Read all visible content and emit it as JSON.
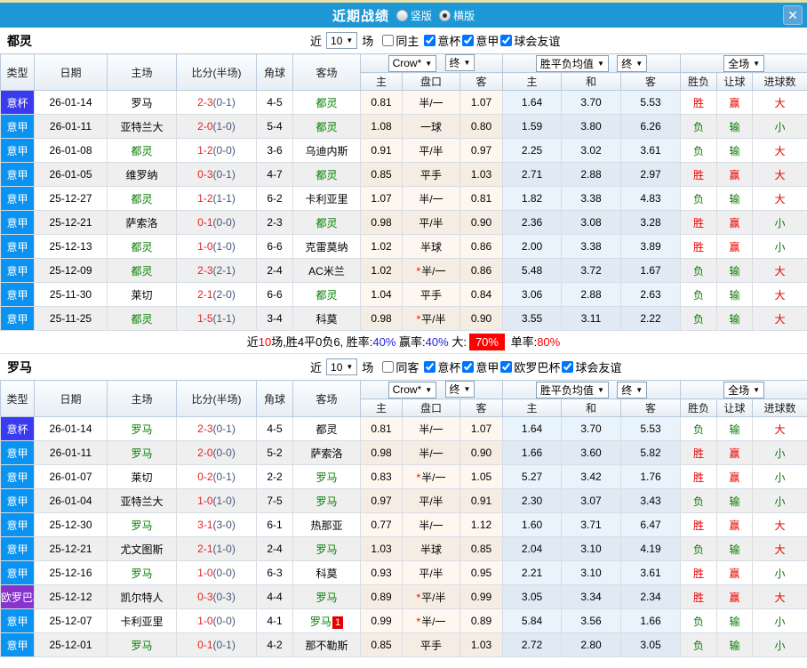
{
  "colors": {
    "titlebar": "#1e97d5",
    "top_strip": "#e9e1aa",
    "league": {
      "意杯": "#3a3af0",
      "意甲": "#0a93f0",
      "欧罗巴杯": "#8833cc"
    },
    "win_red": "#e60000",
    "lose_green": "#067d06",
    "focus_team_green": "#038103",
    "fulltime_score_red": "#e62222",
    "halftime_score_blue": "#44567c",
    "percent_blue": "#2222e6",
    "big_badge_bg": "#ff0000"
  },
  "titlebar": {
    "title": "近期战绩",
    "options": [
      {
        "label": "竖版",
        "selected": false
      },
      {
        "label": "横版",
        "selected": true
      }
    ],
    "close_icon": "✕"
  },
  "table_headers": {
    "type": "类型",
    "date": "日期",
    "home": "主场",
    "score": "比分(半场)",
    "corner": "角球",
    "away": "客场",
    "asia": [
      "主",
      "盘口",
      "客"
    ],
    "europe": [
      "主",
      "和",
      "客"
    ],
    "result": [
      "胜负",
      "让球",
      "进球数"
    ]
  },
  "sections": [
    {
      "team": "都灵",
      "filter": {
        "prefix": "近",
        "count": "10",
        "suffix": "场",
        "same_label": "同主",
        "same_checked": false,
        "leagues": [
          {
            "label": "意杯",
            "checked": true
          },
          {
            "label": "意甲",
            "checked": true
          },
          {
            "label": "球会友谊",
            "checked": true
          }
        ]
      },
      "dropdowns": {
        "bookmaker": "Crow*",
        "final1": "终",
        "avg": "胜平负均值",
        "final2": "终",
        "scope": "全场"
      },
      "rows": [
        {
          "league": "意杯",
          "date": "26-01-14",
          "home": "罗马",
          "home_focus": false,
          "score": "2-3",
          "half": "(0-1)",
          "corner": "4-5",
          "away": "都灵",
          "away_focus": true,
          "redcards": "",
          "h": "0.81",
          "hcap": "半/一",
          "star": false,
          "a": "1.07",
          "w": "1.64",
          "d": "3.70",
          "l": "5.53",
          "res": "胜",
          "rhcap": "赢",
          "rgoal": "大"
        },
        {
          "league": "意甲",
          "date": "26-01-11",
          "home": "亚特兰大",
          "home_focus": false,
          "score": "2-0",
          "half": "(1-0)",
          "corner": "5-4",
          "away": "都灵",
          "away_focus": true,
          "redcards": "",
          "h": "1.08",
          "hcap": "一球",
          "star": false,
          "a": "0.80",
          "w": "1.59",
          "d": "3.80",
          "l": "6.26",
          "res": "负",
          "rhcap": "输",
          "rgoal": "小"
        },
        {
          "league": "意甲",
          "date": "26-01-08",
          "home": "都灵",
          "home_focus": true,
          "score": "1-2",
          "half": "(0-0)",
          "corner": "3-6",
          "away": "乌迪内斯",
          "away_focus": false,
          "redcards": "",
          "h": "0.91",
          "hcap": "平/半",
          "star": false,
          "a": "0.97",
          "w": "2.25",
          "d": "3.02",
          "l": "3.61",
          "res": "负",
          "rhcap": "输",
          "rgoal": "大"
        },
        {
          "league": "意甲",
          "date": "26-01-05",
          "home": "维罗纳",
          "home_focus": false,
          "score": "0-3",
          "half": "(0-1)",
          "corner": "4-7",
          "away": "都灵",
          "away_focus": true,
          "redcards": "",
          "h": "0.85",
          "hcap": "平手",
          "star": false,
          "a": "1.03",
          "w": "2.71",
          "d": "2.88",
          "l": "2.97",
          "res": "胜",
          "rhcap": "赢",
          "rgoal": "大"
        },
        {
          "league": "意甲",
          "date": "25-12-27",
          "home": "都灵",
          "home_focus": true,
          "score": "1-2",
          "half": "(1-1)",
          "corner": "6-2",
          "away": "卡利亚里",
          "away_focus": false,
          "redcards": "",
          "h": "1.07",
          "hcap": "半/一",
          "star": false,
          "a": "0.81",
          "w": "1.82",
          "d": "3.38",
          "l": "4.83",
          "res": "负",
          "rhcap": "输",
          "rgoal": "大"
        },
        {
          "league": "意甲",
          "date": "25-12-21",
          "home": "萨索洛",
          "home_focus": false,
          "score": "0-1",
          "half": "(0-0)",
          "corner": "2-3",
          "away": "都灵",
          "away_focus": true,
          "redcards": "",
          "h": "0.98",
          "hcap": "平/半",
          "star": false,
          "a": "0.90",
          "w": "2.36",
          "d": "3.08",
          "l": "3.28",
          "res": "胜",
          "rhcap": "赢",
          "rgoal": "小"
        },
        {
          "league": "意甲",
          "date": "25-12-13",
          "home": "都灵",
          "home_focus": true,
          "score": "1-0",
          "half": "(1-0)",
          "corner": "6-6",
          "away": "克雷莫纳",
          "away_focus": false,
          "redcards": "",
          "h": "1.02",
          "hcap": "半球",
          "star": false,
          "a": "0.86",
          "w": "2.00",
          "d": "3.38",
          "l": "3.89",
          "res": "胜",
          "rhcap": "赢",
          "rgoal": "小"
        },
        {
          "league": "意甲",
          "date": "25-12-09",
          "home": "都灵",
          "home_focus": true,
          "score": "2-3",
          "half": "(2-1)",
          "corner": "2-4",
          "away": "AC米兰",
          "away_focus": false,
          "redcards": "",
          "h": "1.02",
          "hcap": "半/一",
          "star": true,
          "a": "0.86",
          "w": "5.48",
          "d": "3.72",
          "l": "1.67",
          "res": "负",
          "rhcap": "输",
          "rgoal": "大"
        },
        {
          "league": "意甲",
          "date": "25-11-30",
          "home": "莱切",
          "home_focus": false,
          "score": "2-1",
          "half": "(2-0)",
          "corner": "6-6",
          "away": "都灵",
          "away_focus": true,
          "redcards": "",
          "h": "1.04",
          "hcap": "平手",
          "star": false,
          "a": "0.84",
          "w": "3.06",
          "d": "2.88",
          "l": "2.63",
          "res": "负",
          "rhcap": "输",
          "rgoal": "大"
        },
        {
          "league": "意甲",
          "date": "25-11-25",
          "home": "都灵",
          "home_focus": true,
          "score": "1-5",
          "half": "(1-1)",
          "corner": "3-4",
          "away": "科莫",
          "away_focus": false,
          "redcards": "",
          "h": "0.98",
          "hcap": "平/半",
          "star": true,
          "a": "0.90",
          "w": "3.55",
          "d": "3.11",
          "l": "2.22",
          "res": "负",
          "rhcap": "输",
          "rgoal": "大"
        }
      ],
      "summary": [
        {
          "text": "近"
        },
        {
          "text": "10",
          "style": "red"
        },
        {
          "text": "场,胜4平0负6, "
        },
        {
          "text": "胜率:"
        },
        {
          "text": "40%",
          "style": "blue"
        },
        {
          "text": " 赢率:"
        },
        {
          "text": "40%",
          "style": "blue"
        },
        {
          "text": " 大:"
        },
        {
          "text": "70%",
          "style": "white-on-red"
        },
        {
          "text": " 单率:"
        },
        {
          "text": "80%",
          "style": "red"
        }
      ]
    },
    {
      "team": "罗马",
      "filter": {
        "prefix": "近",
        "count": "10",
        "suffix": "场",
        "same_label": "同客",
        "same_checked": false,
        "leagues": [
          {
            "label": "意杯",
            "checked": true
          },
          {
            "label": "意甲",
            "checked": true
          },
          {
            "label": "欧罗巴杯",
            "checked": true
          },
          {
            "label": "球会友谊",
            "checked": true
          }
        ]
      },
      "dropdowns": {
        "bookmaker": "Crow*",
        "final1": "终",
        "avg": "胜平负均值",
        "final2": "终",
        "scope": "全场"
      },
      "rows": [
        {
          "league": "意杯",
          "date": "26-01-14",
          "home": "罗马",
          "home_focus": true,
          "score": "2-3",
          "half": "(0-1)",
          "corner": "4-5",
          "away": "都灵",
          "away_focus": false,
          "redcards": "",
          "h": "0.81",
          "hcap": "半/一",
          "star": false,
          "a": "1.07",
          "w": "1.64",
          "d": "3.70",
          "l": "5.53",
          "res": "负",
          "rhcap": "输",
          "rgoal": "大"
        },
        {
          "league": "意甲",
          "date": "26-01-11",
          "home": "罗马",
          "home_focus": true,
          "score": "2-0",
          "half": "(0-0)",
          "corner": "5-2",
          "away": "萨索洛",
          "away_focus": false,
          "redcards": "",
          "h": "0.98",
          "hcap": "半/一",
          "star": false,
          "a": "0.90",
          "w": "1.66",
          "d": "3.60",
          "l": "5.82",
          "res": "胜",
          "rhcap": "赢",
          "rgoal": "小"
        },
        {
          "league": "意甲",
          "date": "26-01-07",
          "home": "莱切",
          "home_focus": false,
          "score": "0-2",
          "half": "(0-1)",
          "corner": "2-2",
          "away": "罗马",
          "away_focus": true,
          "redcards": "",
          "h": "0.83",
          "hcap": "半/一",
          "star": true,
          "a": "1.05",
          "w": "5.27",
          "d": "3.42",
          "l": "1.76",
          "res": "胜",
          "rhcap": "赢",
          "rgoal": "小"
        },
        {
          "league": "意甲",
          "date": "26-01-04",
          "home": "亚特兰大",
          "home_focus": false,
          "score": "1-0",
          "half": "(1-0)",
          "corner": "7-5",
          "away": "罗马",
          "away_focus": true,
          "redcards": "",
          "h": "0.97",
          "hcap": "平/半",
          "star": false,
          "a": "0.91",
          "w": "2.30",
          "d": "3.07",
          "l": "3.43",
          "res": "负",
          "rhcap": "输",
          "rgoal": "小"
        },
        {
          "league": "意甲",
          "date": "25-12-30",
          "home": "罗马",
          "home_focus": true,
          "score": "3-1",
          "half": "(3-0)",
          "corner": "6-1",
          "away": "热那亚",
          "away_focus": false,
          "redcards": "",
          "h": "0.77",
          "hcap": "半/一",
          "star": false,
          "a": "1.12",
          "w": "1.60",
          "d": "3.71",
          "l": "6.47",
          "res": "胜",
          "rhcap": "赢",
          "rgoal": "大"
        },
        {
          "league": "意甲",
          "date": "25-12-21",
          "home": "尤文图斯",
          "home_focus": false,
          "score": "2-1",
          "half": "(1-0)",
          "corner": "2-4",
          "away": "罗马",
          "away_focus": true,
          "redcards": "",
          "h": "1.03",
          "hcap": "半球",
          "star": false,
          "a": "0.85",
          "w": "2.04",
          "d": "3.10",
          "l": "4.19",
          "res": "负",
          "rhcap": "输",
          "rgoal": "大"
        },
        {
          "league": "意甲",
          "date": "25-12-16",
          "home": "罗马",
          "home_focus": true,
          "score": "1-0",
          "half": "(0-0)",
          "corner": "6-3",
          "away": "科莫",
          "away_focus": false,
          "redcards": "",
          "h": "0.93",
          "hcap": "平/半",
          "star": false,
          "a": "0.95",
          "w": "2.21",
          "d": "3.10",
          "l": "3.61",
          "res": "胜",
          "rhcap": "赢",
          "rgoal": "小"
        },
        {
          "league": "欧罗巴杯",
          "date": "25-12-12",
          "home": "凯尔特人",
          "home_focus": false,
          "score": "0-3",
          "half": "(0-3)",
          "corner": "4-4",
          "away": "罗马",
          "away_focus": true,
          "redcards": "",
          "h": "0.89",
          "hcap": "平/半",
          "star": true,
          "a": "0.99",
          "w": "3.05",
          "d": "3.34",
          "l": "2.34",
          "res": "胜",
          "rhcap": "赢",
          "rgoal": "大"
        },
        {
          "league": "意甲",
          "date": "25-12-07",
          "home": "卡利亚里",
          "home_focus": false,
          "score": "1-0",
          "half": "(0-0)",
          "corner": "4-1",
          "away": "罗马",
          "away_focus": true,
          "redcards": "1",
          "h": "0.99",
          "hcap": "半/一",
          "star": true,
          "a": "0.89",
          "w": "5.84",
          "d": "3.56",
          "l": "1.66",
          "res": "负",
          "rhcap": "输",
          "rgoal": "小"
        },
        {
          "league": "意甲",
          "date": "25-12-01",
          "home": "罗马",
          "home_focus": true,
          "score": "0-1",
          "half": "(0-1)",
          "corner": "4-2",
          "away": "那不勒斯",
          "away_focus": false,
          "redcards": "",
          "h": "0.85",
          "hcap": "平手",
          "star": false,
          "a": "1.03",
          "w": "2.72",
          "d": "2.80",
          "l": "3.05",
          "res": "负",
          "rhcap": "输",
          "rgoal": "小"
        }
      ],
      "summary": []
    }
  ]
}
